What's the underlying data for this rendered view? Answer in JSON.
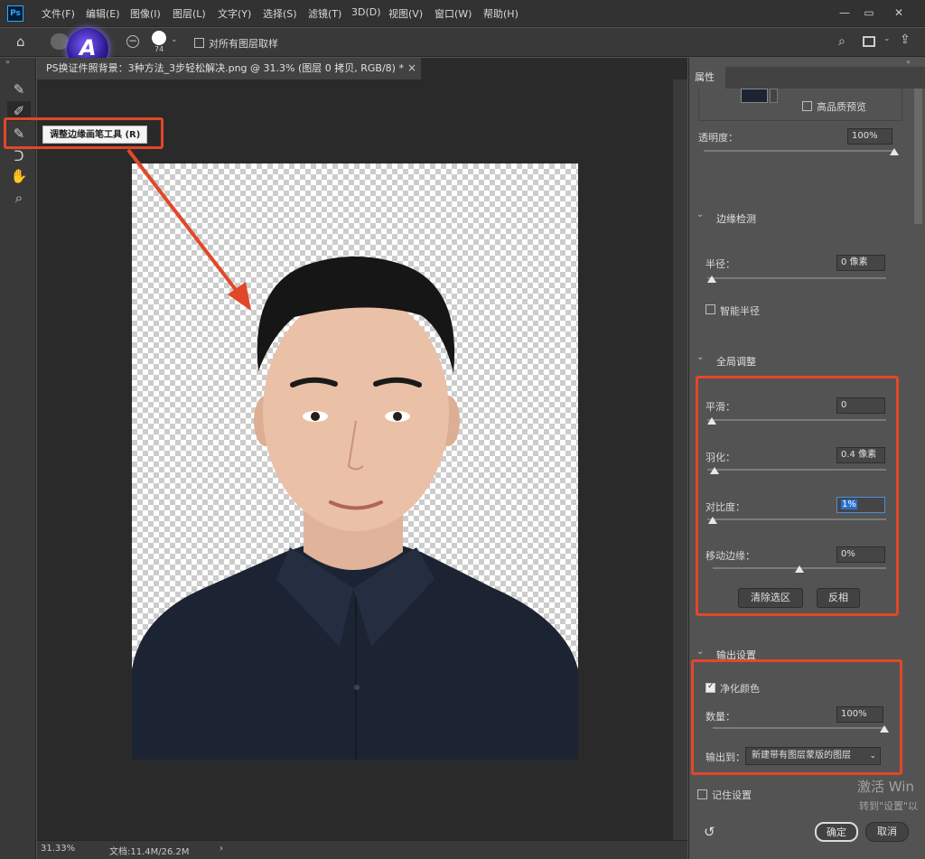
{
  "app": {
    "logo": "Ps"
  },
  "menu": [
    "文件(F)",
    "编辑(E)",
    "图像(I)",
    "图层(L)",
    "文字(Y)",
    "选择(S)",
    "滤镜(T)",
    "3D(D)",
    "视图(V)",
    "窗口(W)",
    "帮助(H)"
  ],
  "window_controls": {
    "minimize": "—",
    "restore": "▭",
    "close": "✕"
  },
  "options": {
    "brush_size": "74",
    "sample_all_layers": "对所有图层取样",
    "watermark_letter": "A"
  },
  "tooltip": "调整边缘画笔工具 (R)",
  "document": {
    "tab_title": "PS换证件照背景：3种方法_3步轻松解决.png @ 31.3% (图层 0 拷贝, RGB/8) *",
    "close": "×"
  },
  "status": {
    "zoom": "31.33%",
    "doc_size": "文档:11.4M/26.2M"
  },
  "panel": {
    "title": "属性",
    "high_quality_preview": "高品质预览",
    "opacity": {
      "label": "透明度：",
      "value": "100%",
      "level": 1.0
    },
    "edge_detection": {
      "title": "边缘检测",
      "radius_label": "半径：",
      "radius_value": "0 像素",
      "radius_level": 0.0,
      "smart_radius": "智能半径"
    },
    "global": {
      "title": "全局调整",
      "smooth": {
        "label": "平滑：",
        "value": "0",
        "level": 0.0
      },
      "feather": {
        "label": "羽化：",
        "value": "0.4 像素",
        "level": 0.02
      },
      "contrast": {
        "label": "对比度：",
        "value": "1%",
        "level": 0.01
      },
      "shift_edge": {
        "label": "移动边缘：",
        "value": "0%",
        "level": 0.5
      },
      "clear_selection": "清除选区",
      "invert": "反相"
    },
    "output": {
      "title": "输出设置",
      "decontaminate": "净化颜色",
      "amount_label": "数量：",
      "amount_value": "100%",
      "amount_level": 1.0,
      "output_to_label": "输出到：",
      "output_to_value": "新建带有图层蒙版的图层"
    },
    "remember": "记住设置",
    "ok": "确定",
    "cancel": "取消"
  },
  "activation": {
    "line1": "激活 Win",
    "line2": "转到\"设置\"以"
  },
  "colors": {
    "highlight": "#e2472a",
    "panel": "#535353",
    "canvas": "#2a2a2a"
  }
}
